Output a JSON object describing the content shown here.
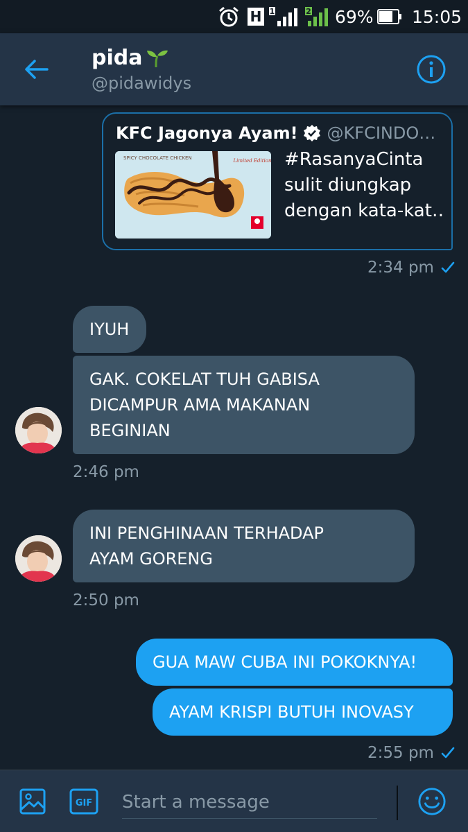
{
  "status_bar": {
    "battery": "69%",
    "time": "15:05",
    "network": "H",
    "sim1": "1",
    "sim2": "2"
  },
  "header": {
    "name": "pida",
    "handle": "@pidawidys"
  },
  "tweet_card": {
    "author": "KFC Jagonya Ayam!",
    "author_handle": "@KFCINDO…",
    "text_lines": [
      "#RasanyaCinta",
      "sulit diungkap",
      "dengan kata-kat…"
    ],
    "image_caption": "SPICY CHOCOLATE CHICKEN",
    "image_badge": "Limited Edition",
    "timestamp": "2:34 pm"
  },
  "messages": [
    {
      "text_lines": [
        "IYUH"
      ]
    },
    {
      "text_lines": [
        "GAK. COKELAT TUH GABISA",
        "DICAMPUR AMA MAKANAN",
        "BEGINIAN"
      ]
    },
    {
      "text_lines": [
        "INI PENGHINAAN TERHADAP",
        "AYAM GORENG"
      ]
    },
    {
      "text_lines": [
        "GUA MAW CUBA INI POKOKNYA!"
      ]
    },
    {
      "text_lines": [
        "AYAM KRISPI BUTUH INOVASY"
      ]
    }
  ],
  "timestamps": {
    "group1": "2:46 pm",
    "group2": "2:50 pm",
    "group3": "2:55 pm"
  },
  "composer": {
    "placeholder": "Start a message",
    "gif_label": "GIF"
  },
  "colors": {
    "background": "#15202b",
    "header": "#243447",
    "accent": "#1da1f2",
    "incoming_bubble": "#3d5466",
    "muted_text": "#8899a6"
  }
}
